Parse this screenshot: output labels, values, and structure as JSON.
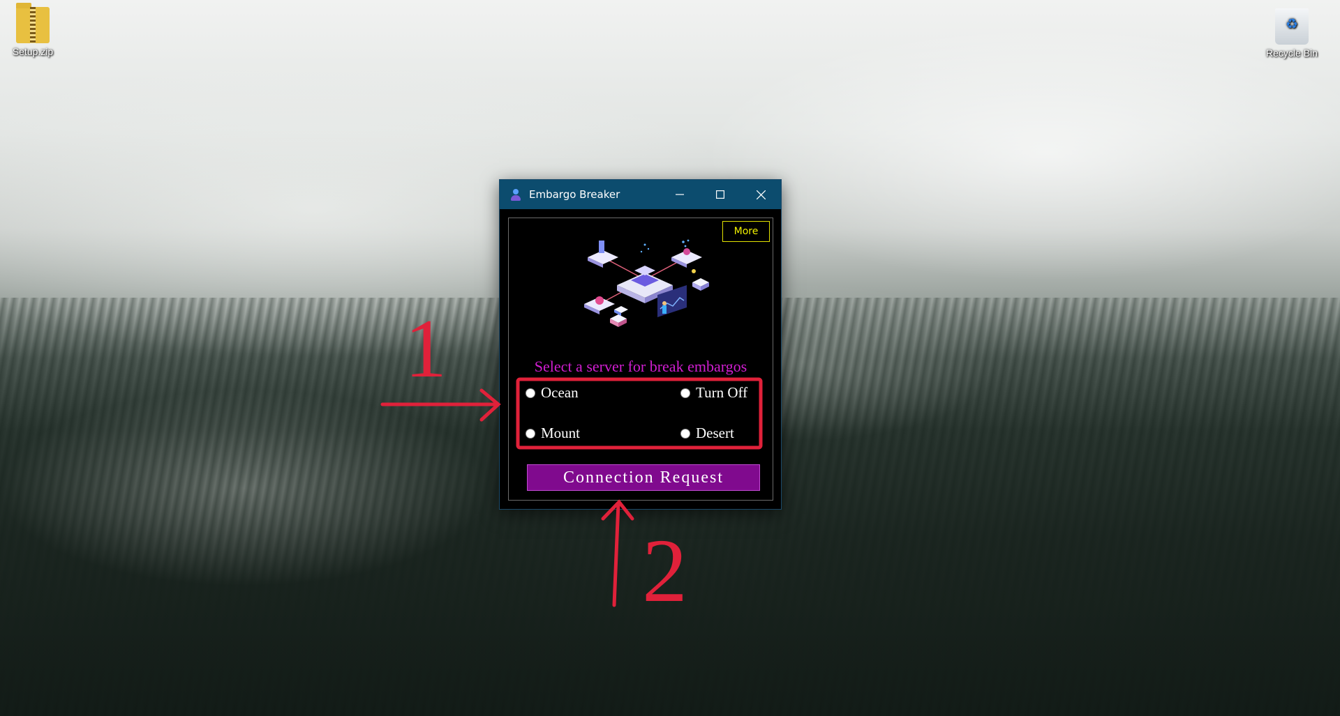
{
  "desktop": {
    "icons": [
      {
        "label": "Setup.zip",
        "icon": "zip-folder-icon"
      },
      {
        "label": "Recycle Bin",
        "icon": "recycle-bin-icon"
      }
    ]
  },
  "window": {
    "title": "Embargo Breaker",
    "controls": {
      "minimize": "minimize-icon",
      "maximize": "maximize-icon",
      "close": "close-icon"
    },
    "more_label": "More",
    "prompt": "Select a server for break embargos",
    "servers": [
      {
        "label": "Ocean",
        "selected": false
      },
      {
        "label": "Turn Off",
        "selected": false
      },
      {
        "label": "Mount",
        "selected": false
      },
      {
        "label": "Desert",
        "selected": false
      }
    ],
    "connect_label": "Connection Request"
  },
  "annotations": {
    "marker_1": "1",
    "marker_2": "2",
    "color": "#e0213a"
  },
  "colors": {
    "titlebar": "#0c4c6e",
    "prompt_text": "#d11ed1",
    "more_border": "#e3e300",
    "connect_button": "#800a8e"
  }
}
